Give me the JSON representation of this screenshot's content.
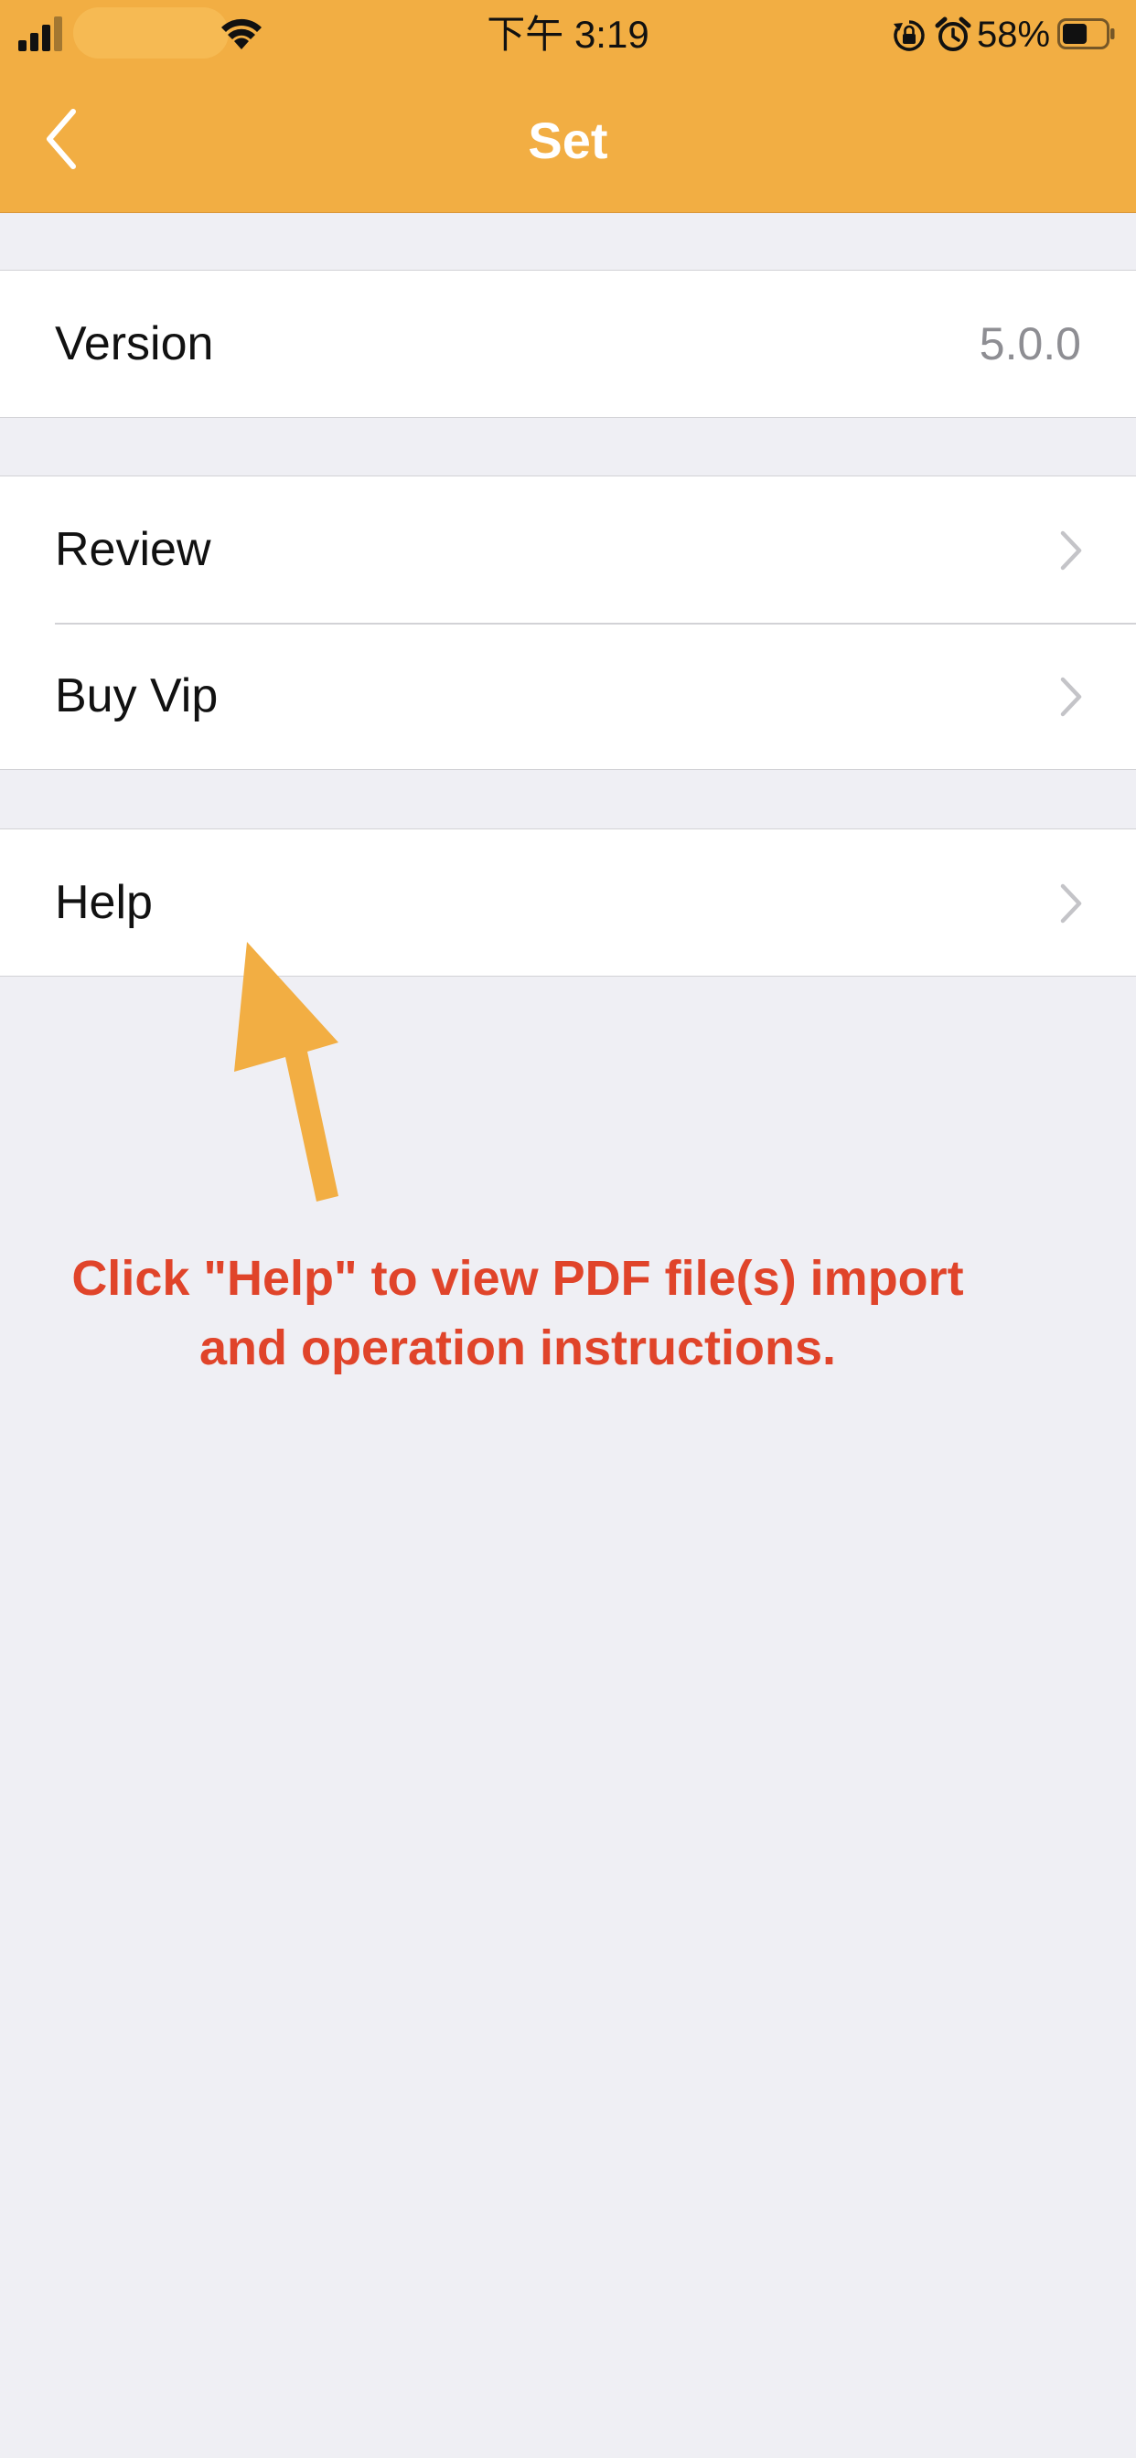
{
  "status_bar": {
    "time": "下午 3:19",
    "battery_percent": "58%",
    "battery_level": 0.58,
    "icons": [
      "signal-icon",
      "wifi-icon",
      "rotation-lock-icon",
      "alarm-icon",
      "battery-icon"
    ]
  },
  "nav": {
    "title": "Set",
    "back_icon": "chevron-left-icon"
  },
  "groups": [
    {
      "rows": [
        {
          "label": "Version",
          "value": "5.0.0"
        }
      ]
    },
    {
      "rows": [
        {
          "label": "Review",
          "icon": "chevron-right-icon"
        },
        {
          "label": "Buy Vip",
          "icon": "chevron-right-icon"
        }
      ]
    },
    {
      "rows": [
        {
          "label": "Help",
          "icon": "chevron-right-icon"
        }
      ]
    }
  ],
  "annotation": {
    "line1": "Click \"Help\" to view PDF file(s) import",
    "line2": "and operation instructions."
  },
  "colors": {
    "header": "#f2ae43",
    "background": "#efeff4",
    "annotation_text": "#e0442a",
    "arrow": "#f2ae43",
    "separator": "#d2d2d6"
  }
}
